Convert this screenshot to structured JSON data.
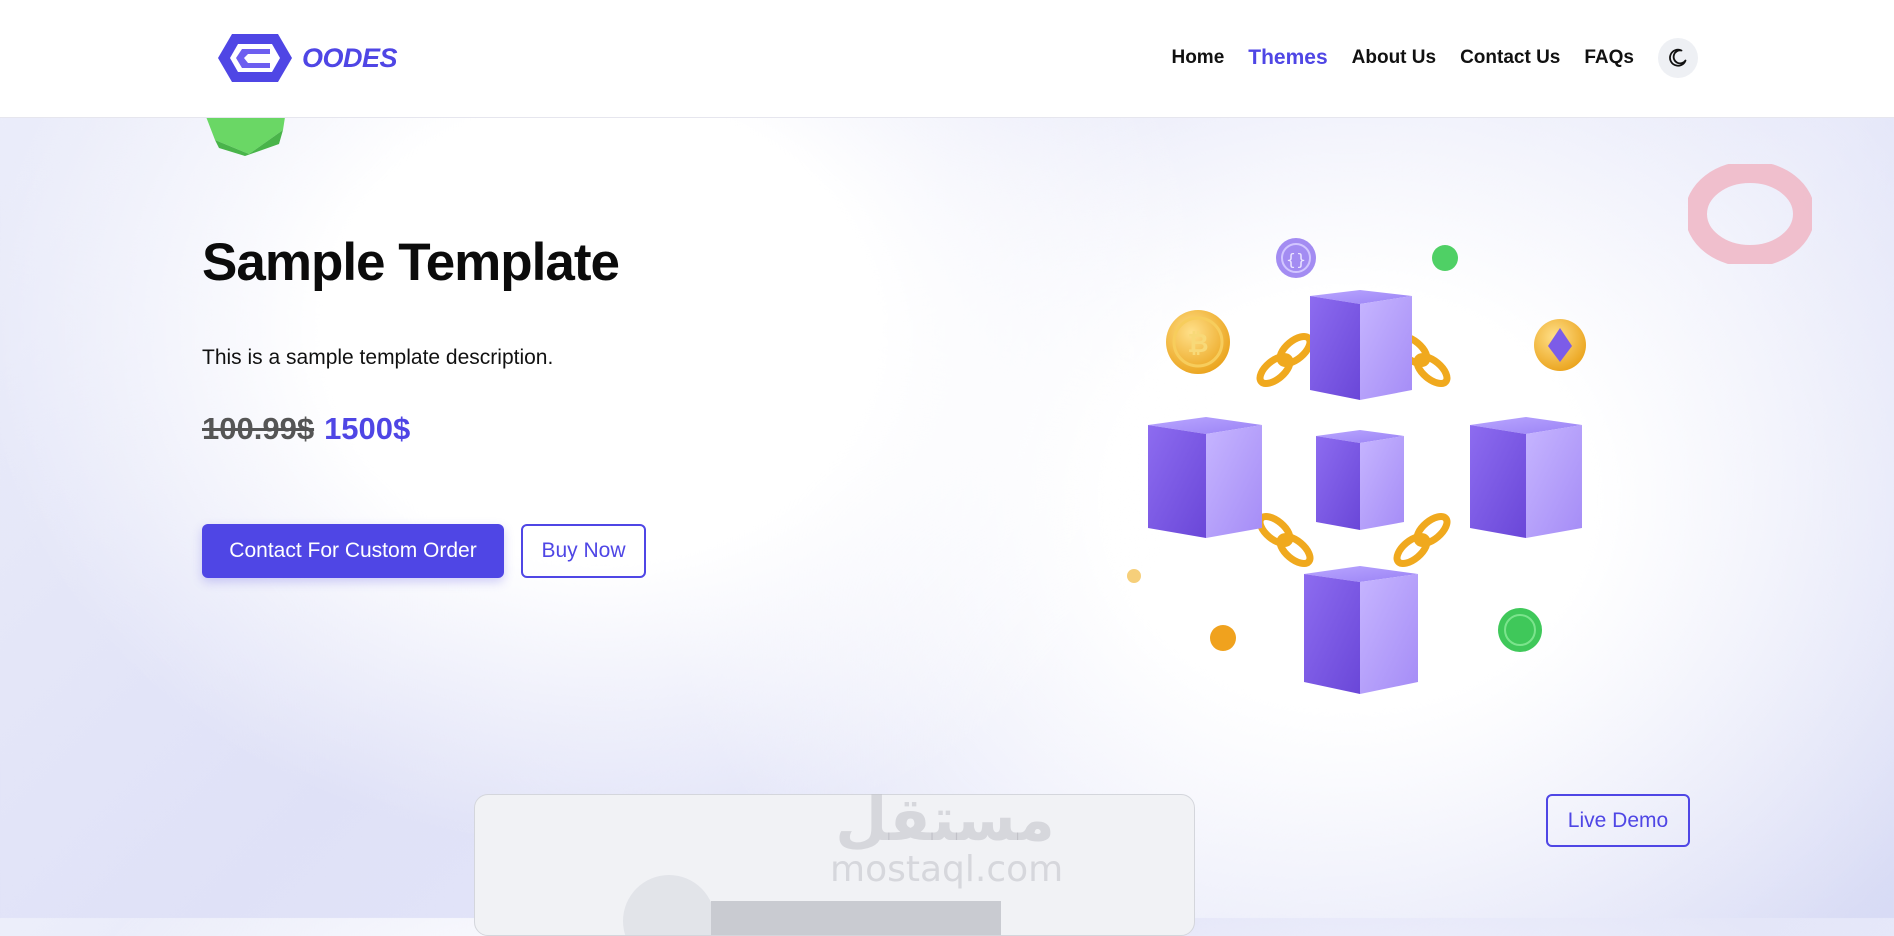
{
  "header": {
    "logo_text": "OODES",
    "nav": [
      {
        "label": "Home",
        "active": false
      },
      {
        "label": "Themes",
        "active": true
      },
      {
        "label": "About Us",
        "active": false
      },
      {
        "label": "Contact Us",
        "active": false
      },
      {
        "label": "FAQs",
        "active": false
      }
    ],
    "theme_toggle_icon": "moon-icon"
  },
  "hero": {
    "title": "Sample Template",
    "description": "This is a sample template description.",
    "old_price": "100.99$",
    "new_price": "1500$",
    "primary_button": "Contact For Custom Order",
    "secondary_button": "Buy Now"
  },
  "preview": {
    "live_demo_button": "Live Demo",
    "watermark_ar": "مستقل",
    "watermark_en": "mostaql.com"
  },
  "colors": {
    "accent": "#4f46e5",
    "cube": "#8b6cf0",
    "coin": "#f5b530",
    "green": "#3fc85a"
  }
}
